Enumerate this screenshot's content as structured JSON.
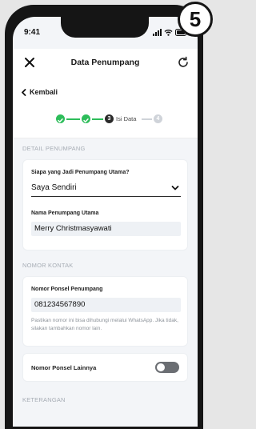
{
  "status_bar": {
    "time": "9:41"
  },
  "header": {
    "title": "Data Penumpang"
  },
  "nav": {
    "back_label": "Kembali"
  },
  "stepper": {
    "current_step_number": "3",
    "current_step_label": "Isi Data",
    "next_step_number": "4"
  },
  "passenger_section": {
    "title": "DETAIL PENUMPANG",
    "main_passenger_label": "Siapa yang Jadi Penumpang Utama?",
    "main_passenger_value": "Saya Sendiri",
    "name_label": "Nama Penumpang Utama",
    "name_value": "Merry Christmasyawati"
  },
  "contact_section": {
    "title": "NOMOR KONTAK",
    "phone_label": "Nomor Ponsel Penumpang",
    "phone_value": "081234567890",
    "phone_helper": "Pastikan nomor ini bisa dihubungi melalui WhatsApp. Jika tidak, silakan tambahkan nomor lain.",
    "other_phone_label": "Nomor Ponsel Lainnya",
    "other_phone_enabled": false
  },
  "notes_section": {
    "title": "KETERANGAN"
  },
  "badge": {
    "number": "5"
  }
}
